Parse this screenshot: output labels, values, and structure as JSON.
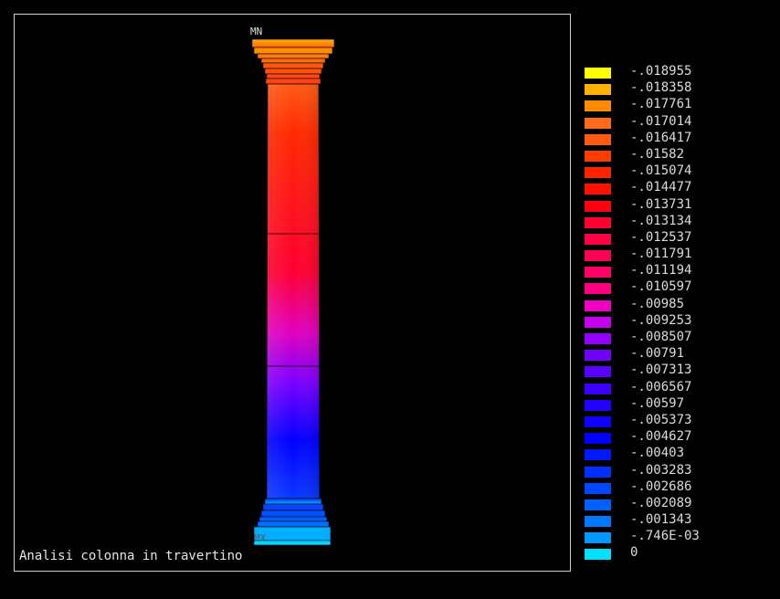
{
  "viewport": {
    "caption": "Analisi colonna in travertino",
    "min_marker": "MN",
    "max_marker": "MX"
  },
  "legend": {
    "entries": [
      {
        "label": "-.018955",
        "color": "#ffff00"
      },
      {
        "label": "-.018358",
        "color": "#ffb000"
      },
      {
        "label": "-.017761",
        "color": "#ff8c00"
      },
      {
        "label": "-.017014",
        "color": "#ff6a1a"
      },
      {
        "label": "-.016417",
        "color": "#ff5a10"
      },
      {
        "label": "-.01582",
        "color": "#ff3c00"
      },
      {
        "label": "-.015074",
        "color": "#ff2400"
      },
      {
        "label": "-.014477",
        "color": "#ff1000"
      },
      {
        "label": "-.013731",
        "color": "#ff0010"
      },
      {
        "label": "-.013134",
        "color": "#ff0030"
      },
      {
        "label": "-.012537",
        "color": "#ff0045"
      },
      {
        "label": "-.011791",
        "color": "#ff0055"
      },
      {
        "label": "-.011194",
        "color": "#ff0066"
      },
      {
        "label": "-.010597",
        "color": "#ff0080"
      },
      {
        "label": "-.00985",
        "color": "#f000c0"
      },
      {
        "label": "-.009253",
        "color": "#c800f0"
      },
      {
        "label": "-.008507",
        "color": "#9400ff"
      },
      {
        "label": "-.00791",
        "color": "#7000ff"
      },
      {
        "label": "-.007313",
        "color": "#5a00ff"
      },
      {
        "label": "-.006567",
        "color": "#3c00ff"
      },
      {
        "label": "-.00597",
        "color": "#2000ff"
      },
      {
        "label": "-.005373",
        "color": "#1000ff"
      },
      {
        "label": "-.004627",
        "color": "#0000ff"
      },
      {
        "label": "-.00403",
        "color": "#0018ff"
      },
      {
        "label": "-.003283",
        "color": "#0030ff"
      },
      {
        "label": "-.002686",
        "color": "#0048ff"
      },
      {
        "label": "-.002089",
        "color": "#0060ff"
      },
      {
        "label": "-.001343",
        "color": "#0078ff"
      },
      {
        "label": "-.746E-03",
        "color": "#0098ff"
      },
      {
        "label": "0",
        "color": "#00e0ff"
      }
    ]
  }
}
